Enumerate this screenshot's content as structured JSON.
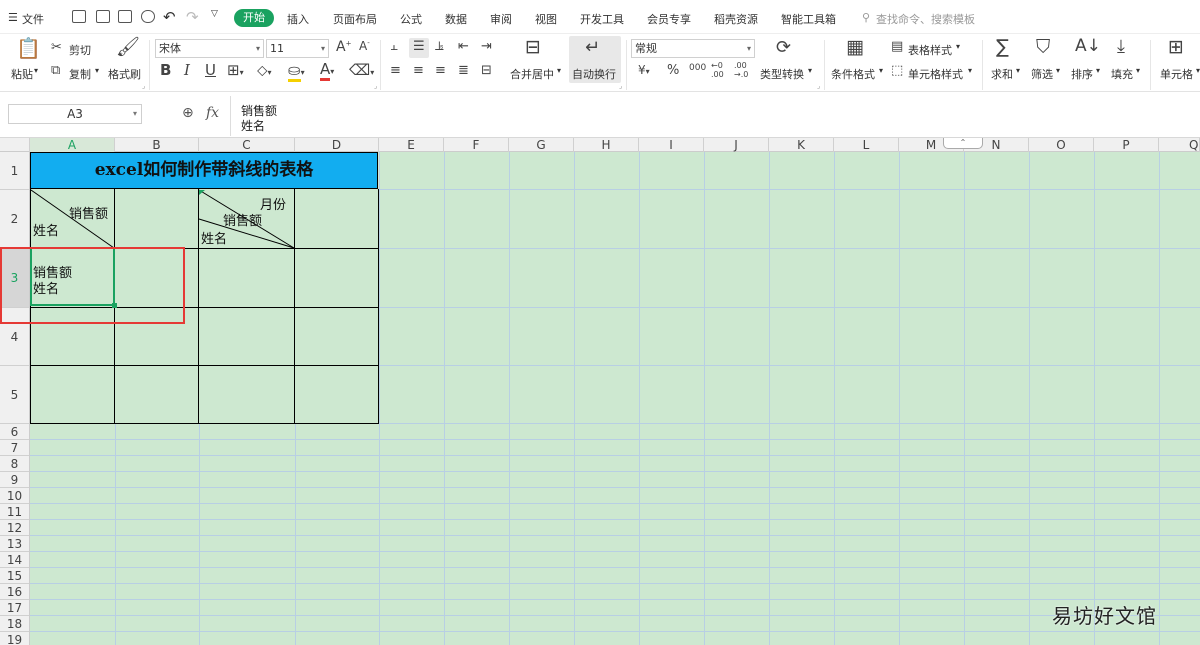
{
  "menubar": {
    "file": "文件",
    "tabs": [
      "开始",
      "插入",
      "页面布局",
      "公式",
      "数据",
      "审阅",
      "视图",
      "开发工具",
      "会员专享",
      "稻壳资源",
      "智能工具箱"
    ],
    "search_placeholder": "查找命令、搜索模板"
  },
  "ribbon": {
    "paste": "粘贴",
    "cut": "剪切",
    "copy": "复制",
    "format_painter": "格式刷",
    "font_name": "宋体",
    "font_size": "11",
    "merge_center": "合并居中",
    "wrap_text": "自动换行",
    "number_format": "常规",
    "type_convert": "类型转换",
    "cond_format": "条件格式",
    "table_style": "表格样式",
    "cell_style": "单元格样式",
    "sum": "求和",
    "filter": "筛选",
    "sort": "排序",
    "fill": "填充",
    "cell": "单元格",
    "bold": "B",
    "italic": "I",
    "underline": "U",
    "font_grow": "A",
    "font_shrink": "A",
    "percent": "%",
    "currency": "¥",
    "thousands": "000"
  },
  "formula_bar": {
    "name_box": "A3",
    "fx": "fx",
    "line1": "销售额",
    "line2": "姓名"
  },
  "columns": [
    "A",
    "B",
    "C",
    "D",
    "E",
    "F",
    "G",
    "H",
    "I",
    "J",
    "K",
    "L",
    "M",
    "N",
    "O",
    "P",
    "Q"
  ],
  "rows": [
    "1",
    "2",
    "3",
    "4",
    "5",
    "6",
    "7",
    "8",
    "9",
    "10",
    "11",
    "12",
    "13",
    "14",
    "15",
    "16",
    "17",
    "18",
    "19"
  ],
  "sheet": {
    "title": "excel如何制作带斜线的表格",
    "a2_top": "销售额",
    "a2_bottom": "姓名",
    "c2_top": "月份",
    "c2_mid": "销售额",
    "c2_bottom": "姓名",
    "a3_line1": "销售额",
    "a3_line2": "姓名"
  },
  "watermark": "易坊好文馆",
  "colors": {
    "accent": "#1aa260",
    "title_fill": "#12adf0",
    "sheet_bg": "#cde8d0",
    "highlight_box": "#e53935"
  }
}
